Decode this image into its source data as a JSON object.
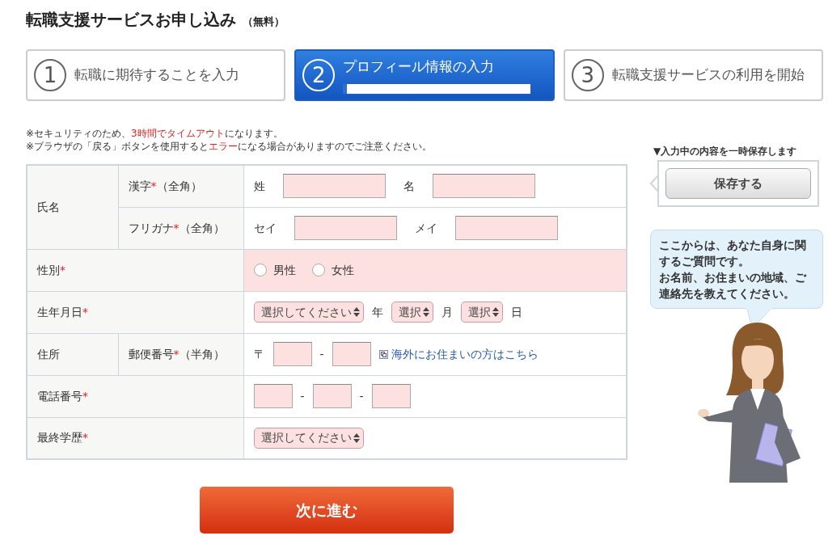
{
  "title": "転職支援サービスお申し込み",
  "title_note": "（無料）",
  "steps": [
    {
      "number": "1",
      "label": "転職に期待することを入力",
      "selected": false
    },
    {
      "number": "2",
      "label": "プロフィール情報の入力",
      "selected": true,
      "level": 0.02
    },
    {
      "number": "3",
      "label": "転職支援サービスの利用を開始",
      "selected": false
    }
  ],
  "notices": [
    [
      {
        "text": "※セキュリティのため、",
        "emphasis": false
      },
      {
        "text": "3時間でタイムアウト",
        "emphasis": true
      },
      {
        "text": "になります。",
        "emphasis": false
      }
    ],
    [
      {
        "text": "※ブラウザの「戻る」ボタンを使用すると",
        "emphasis": false
      },
      {
        "text": "エラー",
        "emphasis": true
      },
      {
        "text": "になる場合がありますのでご注意ください。",
        "emphasis": false
      }
    ]
  ],
  "rows": [
    {
      "label": "氏名",
      "mark": "",
      "highlighted": false,
      "subrows": [
        {
          "label": "漢字",
          "mark": "*",
          "note": "（全角）",
          "parts": [
            {
              "kind": "text",
              "text": "姓"
            },
            {
              "kind": "wide_input"
            },
            {
              "kind": "text",
              "text": "名"
            },
            {
              "kind": "wide_input"
            }
          ]
        },
        {
          "label": "フリガナ",
          "mark": "*",
          "note": "（全角）",
          "parts": [
            {
              "kind": "text",
              "text": "セイ"
            },
            {
              "kind": "wide_input"
            },
            {
              "kind": "text",
              "text": "メイ"
            },
            {
              "kind": "wide_input"
            }
          ]
        }
      ]
    },
    {
      "label": "性別",
      "mark": "*",
      "highlighted": true,
      "parts": [
        {
          "kind": "radio",
          "text": "男性",
          "selected": false
        },
        {
          "kind": "radio",
          "text": "女性",
          "selected": false
        }
      ]
    },
    {
      "label": "生年月日",
      "mark": "*",
      "highlighted": false,
      "parts": [
        {
          "kind": "select",
          "text": "選択してください"
        },
        {
          "kind": "text",
          "text": "年"
        },
        {
          "kind": "select",
          "text": "選択"
        },
        {
          "kind": "text",
          "text": "月"
        },
        {
          "kind": "select",
          "text": "選択"
        },
        {
          "kind": "text",
          "text": "日"
        }
      ]
    },
    {
      "label": "住所",
      "mark": "",
      "highlighted": false,
      "subrows": [
        {
          "label": "郵便番号",
          "mark": "*",
          "note": "（半角）",
          "parts": [
            {
              "kind": "text",
              "text": "〒"
            },
            {
              "kind": "short_input"
            },
            {
              "kind": "text",
              "text": "-"
            },
            {
              "kind": "short_input"
            },
            {
              "kind": "link",
              "text": "海外にお住まいの方はこちら"
            }
          ]
        }
      ]
    },
    {
      "label": "電話番号",
      "mark": "*",
      "highlighted": false,
      "parts": [
        {
          "kind": "short_input"
        },
        {
          "kind": "text",
          "text": "-"
        },
        {
          "kind": "short_input"
        },
        {
          "kind": "text",
          "text": "-"
        },
        {
          "kind": "short_input"
        }
      ]
    },
    {
      "label": "最終学歴",
      "mark": "*",
      "highlighted": false,
      "parts": [
        {
          "kind": "select",
          "text": "選択してください"
        }
      ]
    }
  ],
  "next_button": "次に進む",
  "save": {
    "caption": "▼入力中の内容を一時保存します",
    "button": "保存する"
  },
  "bubble": [
    "ここからは、あなた自身に関するご質問です。",
    "お名前、お住まいの地域、ご連絡先を教えてください。"
  ]
}
